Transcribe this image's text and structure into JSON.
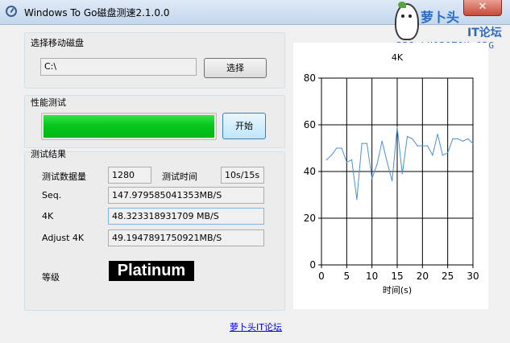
{
  "window": {
    "title": "Windows To Go磁盘测速2.1.0.0",
    "close_label": "✕"
  },
  "logo": {
    "name": "萝卜头",
    "sub": "IT论坛",
    "url": "BBS.LUOBOTOU.ORG"
  },
  "drive_group": {
    "label": "选择移动磁盘",
    "path": "C:\\",
    "select_label": "选择"
  },
  "perf_group": {
    "label": "性能测试",
    "start_label": "开始",
    "progress": 1.0,
    "progress_color": "#06c71d"
  },
  "results": {
    "label": "测试结果",
    "data_size_label": "测试数据量",
    "data_size": "1280",
    "time_label": "测试时间",
    "time": "10s/15s",
    "seq_label": "Seq.",
    "seq_value": "147.979585041353MB/S",
    "k4_label": "4K",
    "k4_value": "48.323318931709 MB/S",
    "adj_label": "Adjust 4K",
    "adj_value": "49.1947891750921MB/S",
    "grade_label": "等级",
    "grade_value": "Platinum"
  },
  "footer": {
    "link": "萝卜头IT论坛"
  },
  "chart_data": {
    "type": "line",
    "title": "4K",
    "xlabel": "时间(s)",
    "ylabel": "",
    "xlim": [
      0,
      30
    ],
    "ylim": [
      0,
      80
    ],
    "x_ticks": [
      0,
      5,
      10,
      15,
      20,
      25,
      30
    ],
    "y_ticks": [
      0,
      20,
      40,
      60,
      80
    ],
    "grid": true,
    "color": "#4a90d9",
    "series": [
      {
        "x": [
          1,
          2,
          3,
          4,
          5,
          6,
          7,
          8,
          9,
          10,
          11,
          12,
          13,
          14,
          15,
          16,
          17,
          18,
          19,
          20,
          21,
          22,
          23,
          24,
          25,
          26,
          27,
          28,
          29,
          30
        ],
        "values": [
          45,
          47,
          50,
          50,
          44,
          45,
          28,
          52,
          52,
          37,
          43,
          53,
          44,
          36,
          59,
          39,
          55,
          54,
          51,
          51,
          51,
          47,
          56,
          47,
          48,
          54,
          54,
          53,
          54,
          52
        ]
      }
    ]
  }
}
